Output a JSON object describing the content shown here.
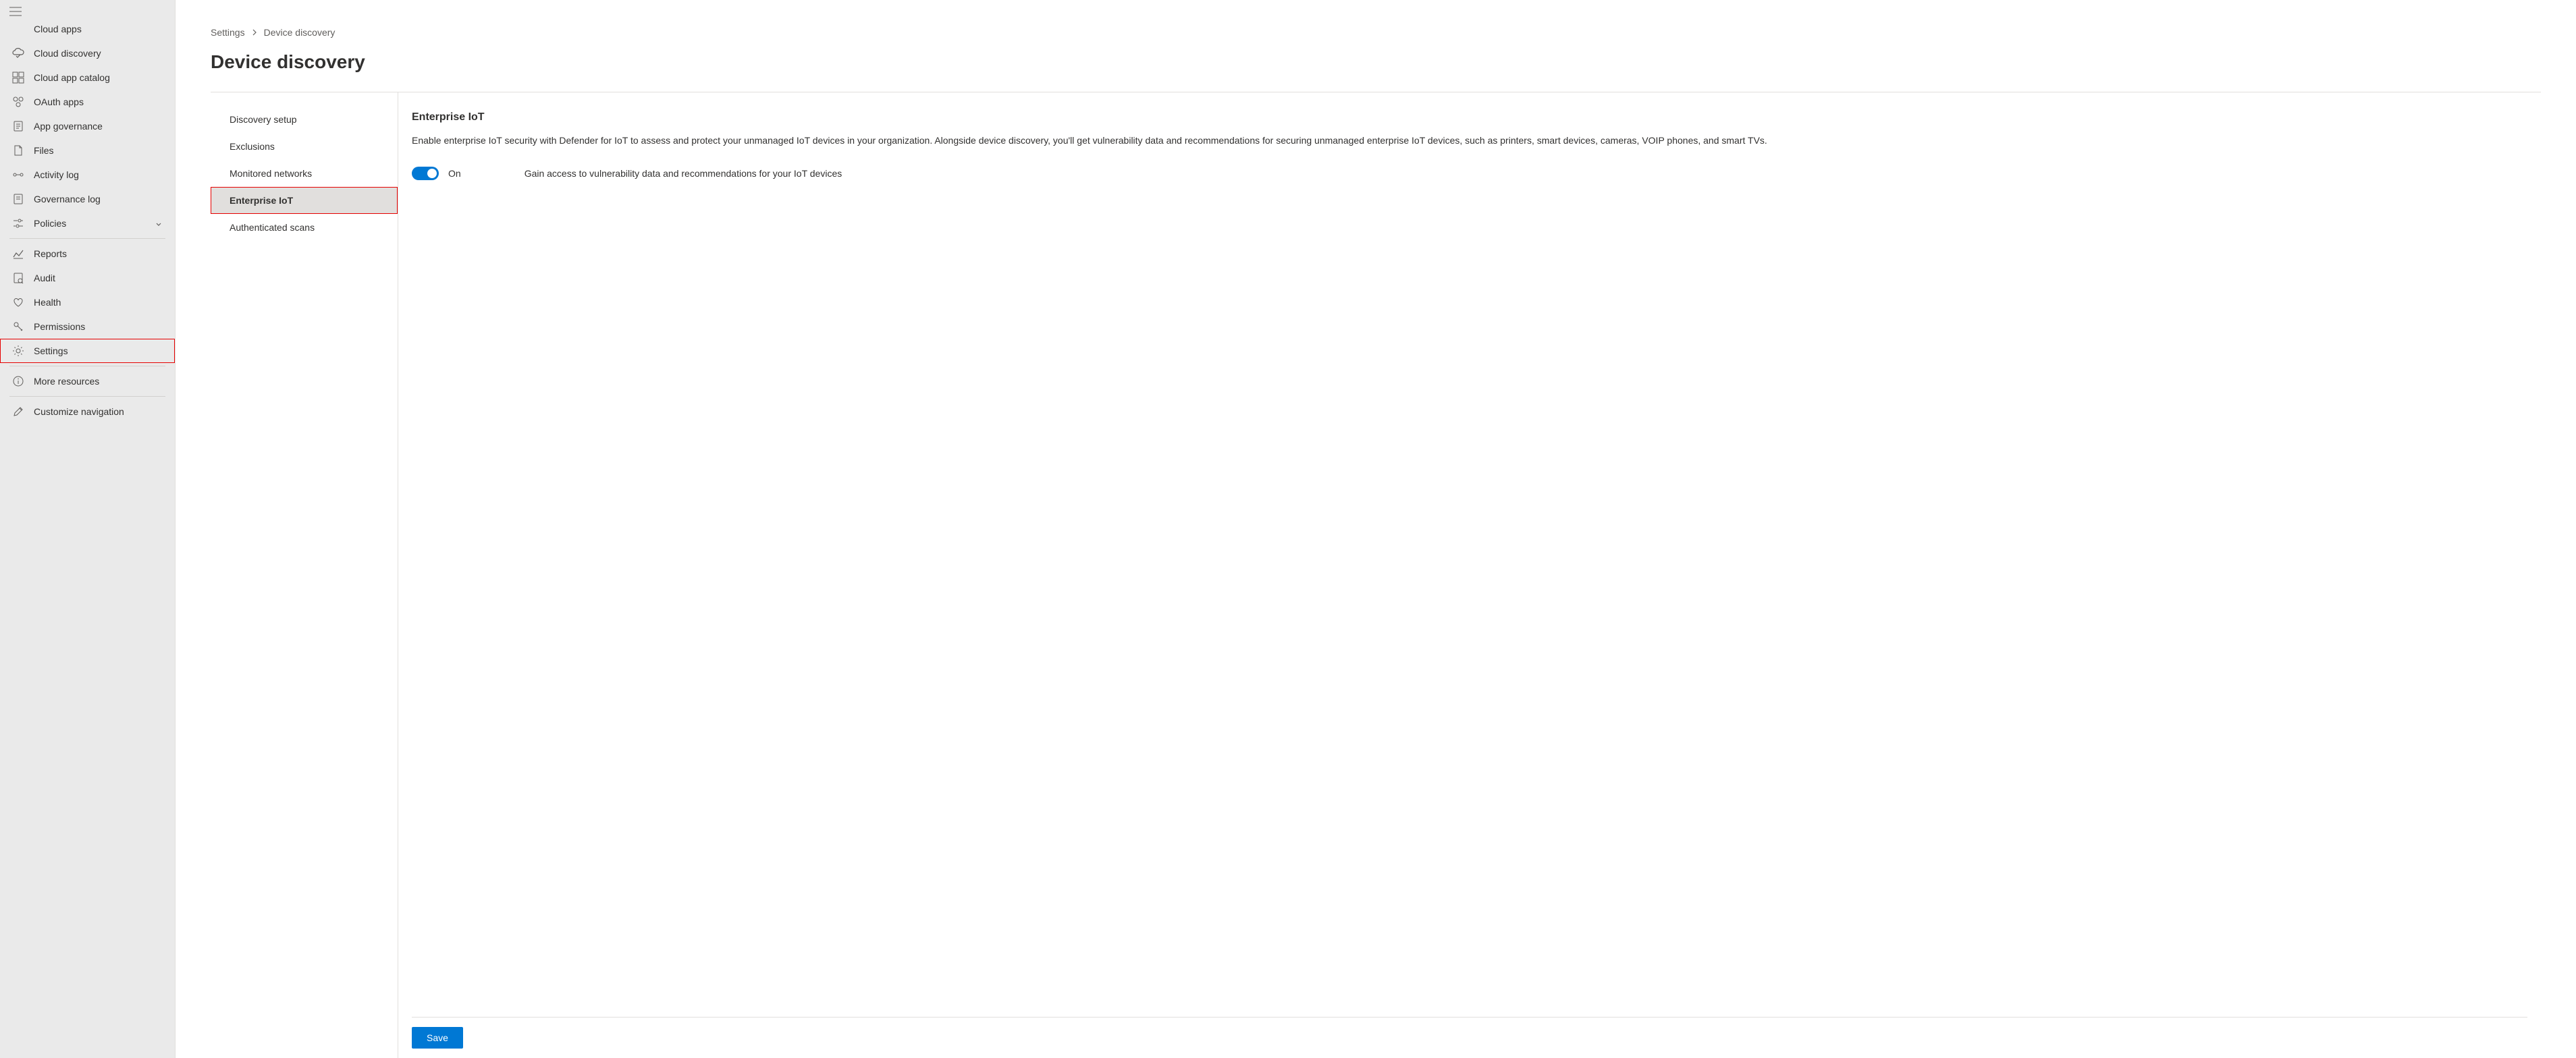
{
  "sidebar": {
    "cut_off_label": "Cloud apps",
    "items": [
      {
        "icon": "cloud-discovery",
        "label": "Cloud discovery"
      },
      {
        "icon": "catalog",
        "label": "Cloud app catalog"
      },
      {
        "icon": "oauth",
        "label": "OAuth apps"
      },
      {
        "icon": "governance",
        "label": "App governance"
      },
      {
        "icon": "files",
        "label": "Files"
      },
      {
        "icon": "activity",
        "label": "Activity log"
      },
      {
        "icon": "gov-log",
        "label": "Governance log"
      },
      {
        "icon": "policies",
        "label": "Policies",
        "chevron": true
      }
    ],
    "items2": [
      {
        "icon": "reports",
        "label": "Reports"
      },
      {
        "icon": "audit",
        "label": "Audit"
      },
      {
        "icon": "health",
        "label": "Health"
      },
      {
        "icon": "permissions",
        "label": "Permissions"
      },
      {
        "icon": "settings",
        "label": "Settings",
        "highlighted": true
      }
    ],
    "items3": [
      {
        "icon": "more",
        "label": "More resources"
      }
    ],
    "items4": [
      {
        "icon": "customize",
        "label": "Customize navigation"
      }
    ]
  },
  "breadcrumb": {
    "item1": "Settings",
    "item2": "Device discovery"
  },
  "page_title": "Device discovery",
  "sub_nav": {
    "items": [
      {
        "label": "Discovery setup"
      },
      {
        "label": "Exclusions"
      },
      {
        "label": "Monitored networks"
      },
      {
        "label": "Enterprise IoT",
        "selected": true,
        "highlighted": true
      },
      {
        "label": "Authenticated scans"
      }
    ]
  },
  "detail": {
    "title": "Enterprise IoT",
    "description": "Enable enterprise IoT security with Defender for IoT to assess and protect your unmanaged IoT devices in your organization. Alongside device discovery, you'll get vulnerability data and recommendations for securing unmanaged enterprise IoT devices, such as printers, smart devices, cameras, VOIP phones, and smart TVs.",
    "toggle_label": "On",
    "toggle_description": "Gain access to vulnerability data and recommendations for your IoT devices",
    "save_label": "Save"
  }
}
